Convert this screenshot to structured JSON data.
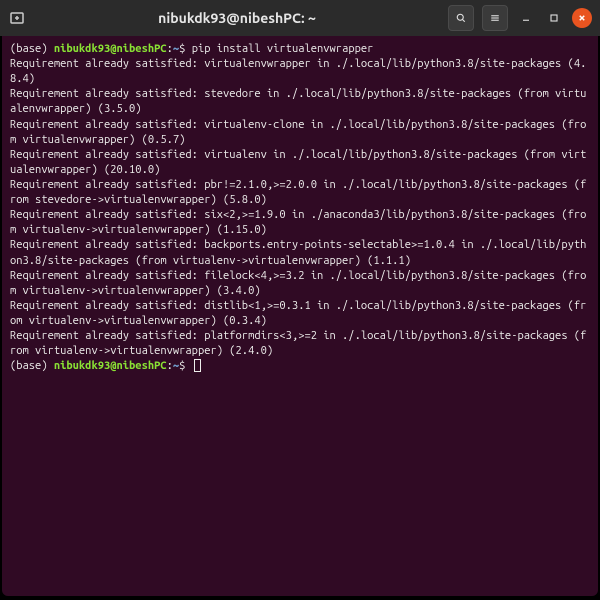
{
  "titlebar": {
    "title": "nibukdk93@nibeshPC: ~"
  },
  "prompt1": {
    "base": "(base) ",
    "user": "nibukdk93@nibeshPC",
    "sep": ":",
    "path": "~",
    "dollar": "$ ",
    "command": "pip install virtualenvwrapper"
  },
  "output": [
    "Requirement already satisfied: virtualenvwrapper in ./.local/lib/python3.8/site-packages (4.8.4)",
    "Requirement already satisfied: stevedore in ./.local/lib/python3.8/site-packages (from virtualenvwrapper) (3.5.0)",
    "Requirement already satisfied: virtualenv-clone in ./.local/lib/python3.8/site-packages (from virtualenvwrapper) (0.5.7)",
    "Requirement already satisfied: virtualenv in ./.local/lib/python3.8/site-packages (from virtualenvwrapper) (20.10.0)",
    "Requirement already satisfied: pbr!=2.1.0,>=2.0.0 in ./.local/lib/python3.8/site-packages (from stevedore->virtualenvwrapper) (5.8.0)",
    "Requirement already satisfied: six<2,>=1.9.0 in ./anaconda3/lib/python3.8/site-packages (from virtualenv->virtualenvwrapper) (1.15.0)",
    "Requirement already satisfied: backports.entry-points-selectable>=1.0.4 in ./.local/lib/python3.8/site-packages (from virtualenv->virtualenvwrapper) (1.1.1)",
    "Requirement already satisfied: filelock<4,>=3.2 in ./.local/lib/python3.8/site-packages (from virtualenv->virtualenvwrapper) (3.4.0)",
    "Requirement already satisfied: distlib<1,>=0.3.1 in ./.local/lib/python3.8/site-packages (from virtualenv->virtualenvwrapper) (0.3.4)",
    "Requirement already satisfied: platformdirs<3,>=2 in ./.local/lib/python3.8/site-packages (from virtualenv->virtualenvwrapper) (2.4.0)"
  ],
  "prompt2": {
    "base": "(base) ",
    "user": "nibukdk93@nibeshPC",
    "sep": ":",
    "path": "~",
    "dollar": "$ "
  }
}
